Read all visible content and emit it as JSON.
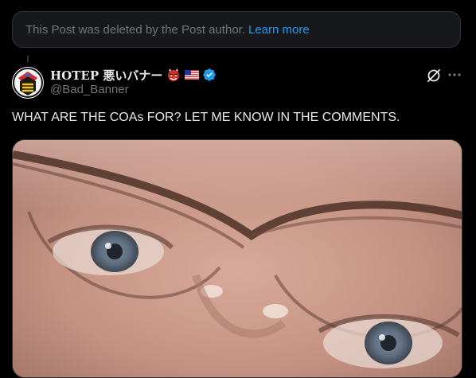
{
  "notice": {
    "text": "This Post was deleted by the Post author.",
    "link_label": "Learn more"
  },
  "post": {
    "author": {
      "display_name": "HOTEP 悪いバナー",
      "handle": "@Bad_Banner",
      "verified": true,
      "badges": [
        "oni-mask-icon",
        "us-flag-icon"
      ]
    },
    "text": "WHAT ARE THE COAs FOR? LET ME KNOW IN THE COMMENTS.",
    "media": {
      "description_icon": "photo"
    }
  },
  "colors": {
    "background": "#000000",
    "text_primary": "#e7e9ea",
    "text_secondary": "#71767b",
    "link": "#1d9bf0",
    "border": "#2f3336",
    "verified": "#1d9bf0"
  }
}
